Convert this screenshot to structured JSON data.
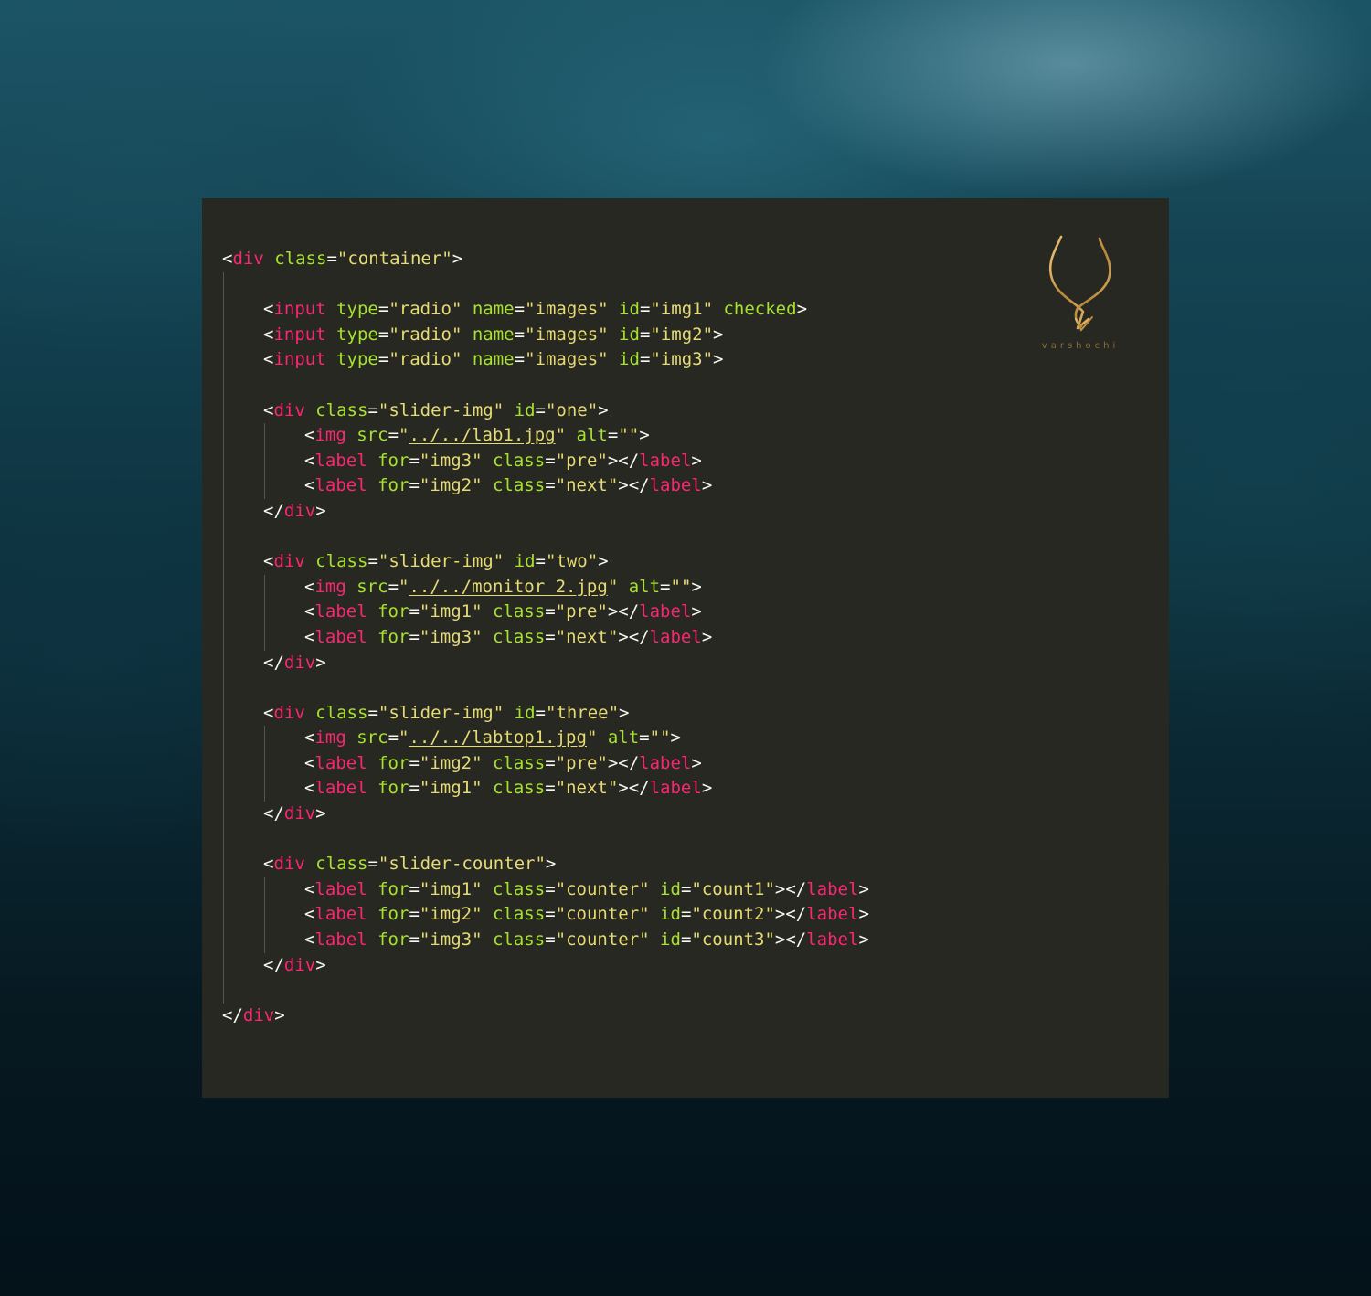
{
  "editor": {
    "lines": [
      {
        "indent": 0,
        "tokens": [
          [
            "pun",
            "<"
          ],
          [
            "tag",
            "div"
          ],
          [
            "pun",
            " "
          ],
          [
            "attr",
            "class"
          ],
          [
            "pun",
            "="
          ],
          [
            "str",
            "\"container\""
          ],
          [
            "pun",
            ">"
          ]
        ]
      },
      {
        "indent": 0,
        "tokens": []
      },
      {
        "indent": 1,
        "tokens": [
          [
            "pun",
            "<"
          ],
          [
            "tag",
            "input"
          ],
          [
            "pun",
            " "
          ],
          [
            "attr",
            "type"
          ],
          [
            "pun",
            "="
          ],
          [
            "str",
            "\"radio\""
          ],
          [
            "pun",
            " "
          ],
          [
            "attr",
            "name"
          ],
          [
            "pun",
            "="
          ],
          [
            "str",
            "\"images\""
          ],
          [
            "pun",
            " "
          ],
          [
            "attr",
            "id"
          ],
          [
            "pun",
            "="
          ],
          [
            "str",
            "\"img1\""
          ],
          [
            "pun",
            " "
          ],
          [
            "attr",
            "checked"
          ],
          [
            "pun",
            ">"
          ]
        ]
      },
      {
        "indent": 1,
        "tokens": [
          [
            "pun",
            "<"
          ],
          [
            "tag",
            "input"
          ],
          [
            "pun",
            " "
          ],
          [
            "attr",
            "type"
          ],
          [
            "pun",
            "="
          ],
          [
            "str",
            "\"radio\""
          ],
          [
            "pun",
            " "
          ],
          [
            "attr",
            "name"
          ],
          [
            "pun",
            "="
          ],
          [
            "str",
            "\"images\""
          ],
          [
            "pun",
            " "
          ],
          [
            "attr",
            "id"
          ],
          [
            "pun",
            "="
          ],
          [
            "str",
            "\"img2\""
          ],
          [
            "pun",
            ">"
          ]
        ]
      },
      {
        "indent": 1,
        "tokens": [
          [
            "pun",
            "<"
          ],
          [
            "tag",
            "input"
          ],
          [
            "pun",
            " "
          ],
          [
            "attr",
            "type"
          ],
          [
            "pun",
            "="
          ],
          [
            "str",
            "\"radio\""
          ],
          [
            "pun",
            " "
          ],
          [
            "attr",
            "name"
          ],
          [
            "pun",
            "="
          ],
          [
            "str",
            "\"images\""
          ],
          [
            "pun",
            " "
          ],
          [
            "attr",
            "id"
          ],
          [
            "pun",
            "="
          ],
          [
            "str",
            "\"img3\""
          ],
          [
            "pun",
            ">"
          ]
        ]
      },
      {
        "indent": 0,
        "tokens": []
      },
      {
        "indent": 1,
        "tokens": [
          [
            "pun",
            "<"
          ],
          [
            "tag",
            "div"
          ],
          [
            "pun",
            " "
          ],
          [
            "attr",
            "class"
          ],
          [
            "pun",
            "="
          ],
          [
            "str",
            "\"slider-img\""
          ],
          [
            "pun",
            " "
          ],
          [
            "attr",
            "id"
          ],
          [
            "pun",
            "="
          ],
          [
            "str",
            "\"one\""
          ],
          [
            "pun",
            ">"
          ]
        ]
      },
      {
        "indent": 2,
        "tokens": [
          [
            "pun",
            "<"
          ],
          [
            "tag",
            "img"
          ],
          [
            "pun",
            " "
          ],
          [
            "attr",
            "src"
          ],
          [
            "pun",
            "="
          ],
          [
            "str",
            "\""
          ],
          [
            "link",
            "../../lab1.jpg"
          ],
          [
            "str",
            "\""
          ],
          [
            "pun",
            " "
          ],
          [
            "attr",
            "alt"
          ],
          [
            "pun",
            "="
          ],
          [
            "str",
            "\"\""
          ],
          [
            "pun",
            ">"
          ]
        ]
      },
      {
        "indent": 2,
        "tokens": [
          [
            "pun",
            "<"
          ],
          [
            "tag",
            "label"
          ],
          [
            "pun",
            " "
          ],
          [
            "attr",
            "for"
          ],
          [
            "pun",
            "="
          ],
          [
            "str",
            "\"img3\""
          ],
          [
            "pun",
            " "
          ],
          [
            "attr",
            "class"
          ],
          [
            "pun",
            "="
          ],
          [
            "str",
            "\"pre\""
          ],
          [
            "pun",
            "></"
          ],
          [
            "tag",
            "label"
          ],
          [
            "pun",
            ">"
          ]
        ]
      },
      {
        "indent": 2,
        "tokens": [
          [
            "pun",
            "<"
          ],
          [
            "tag",
            "label"
          ],
          [
            "pun",
            " "
          ],
          [
            "attr",
            "for"
          ],
          [
            "pun",
            "="
          ],
          [
            "str",
            "\"img2\""
          ],
          [
            "pun",
            " "
          ],
          [
            "attr",
            "class"
          ],
          [
            "pun",
            "="
          ],
          [
            "str",
            "\"next\""
          ],
          [
            "pun",
            "></"
          ],
          [
            "tag",
            "label"
          ],
          [
            "pun",
            ">"
          ]
        ]
      },
      {
        "indent": 1,
        "tokens": [
          [
            "pun",
            "</"
          ],
          [
            "tag",
            "div"
          ],
          [
            "pun",
            ">"
          ]
        ]
      },
      {
        "indent": 0,
        "tokens": []
      },
      {
        "indent": 1,
        "tokens": [
          [
            "pun",
            "<"
          ],
          [
            "tag",
            "div"
          ],
          [
            "pun",
            " "
          ],
          [
            "attr",
            "class"
          ],
          [
            "pun",
            "="
          ],
          [
            "str",
            "\"slider-img\""
          ],
          [
            "pun",
            " "
          ],
          [
            "attr",
            "id"
          ],
          [
            "pun",
            "="
          ],
          [
            "str",
            "\"two\""
          ],
          [
            "pun",
            ">"
          ]
        ]
      },
      {
        "indent": 2,
        "tokens": [
          [
            "pun",
            "<"
          ],
          [
            "tag",
            "img"
          ],
          [
            "pun",
            " "
          ],
          [
            "attr",
            "src"
          ],
          [
            "pun",
            "="
          ],
          [
            "str",
            "\""
          ],
          [
            "link",
            "../../monitor 2.jpg"
          ],
          [
            "str",
            "\""
          ],
          [
            "pun",
            " "
          ],
          [
            "attr",
            "alt"
          ],
          [
            "pun",
            "="
          ],
          [
            "str",
            "\"\""
          ],
          [
            "pun",
            ">"
          ]
        ]
      },
      {
        "indent": 2,
        "tokens": [
          [
            "pun",
            "<"
          ],
          [
            "tag",
            "label"
          ],
          [
            "pun",
            " "
          ],
          [
            "attr",
            "for"
          ],
          [
            "pun",
            "="
          ],
          [
            "str",
            "\"img1\""
          ],
          [
            "pun",
            " "
          ],
          [
            "attr",
            "class"
          ],
          [
            "pun",
            "="
          ],
          [
            "str",
            "\"pre\""
          ],
          [
            "pun",
            "></"
          ],
          [
            "tag",
            "label"
          ],
          [
            "pun",
            ">"
          ]
        ]
      },
      {
        "indent": 2,
        "tokens": [
          [
            "pun",
            "<"
          ],
          [
            "tag",
            "label"
          ],
          [
            "pun",
            " "
          ],
          [
            "attr",
            "for"
          ],
          [
            "pun",
            "="
          ],
          [
            "str",
            "\"img3\""
          ],
          [
            "pun",
            " "
          ],
          [
            "attr",
            "class"
          ],
          [
            "pun",
            "="
          ],
          [
            "str",
            "\"next\""
          ],
          [
            "pun",
            "></"
          ],
          [
            "tag",
            "label"
          ],
          [
            "pun",
            ">"
          ]
        ]
      },
      {
        "indent": 1,
        "tokens": [
          [
            "pun",
            "</"
          ],
          [
            "tag",
            "div"
          ],
          [
            "pun",
            ">"
          ]
        ]
      },
      {
        "indent": 0,
        "tokens": []
      },
      {
        "indent": 1,
        "tokens": [
          [
            "pun",
            "<"
          ],
          [
            "tag",
            "div"
          ],
          [
            "pun",
            " "
          ],
          [
            "attr",
            "class"
          ],
          [
            "pun",
            "="
          ],
          [
            "str",
            "\"slider-img\""
          ],
          [
            "pun",
            " "
          ],
          [
            "attr",
            "id"
          ],
          [
            "pun",
            "="
          ],
          [
            "str",
            "\"three\""
          ],
          [
            "pun",
            ">"
          ]
        ]
      },
      {
        "indent": 2,
        "tokens": [
          [
            "pun",
            "<"
          ],
          [
            "tag",
            "img"
          ],
          [
            "pun",
            " "
          ],
          [
            "attr",
            "src"
          ],
          [
            "pun",
            "="
          ],
          [
            "str",
            "\""
          ],
          [
            "link",
            "../../labtop1.jpg"
          ],
          [
            "str",
            "\""
          ],
          [
            "pun",
            " "
          ],
          [
            "attr",
            "alt"
          ],
          [
            "pun",
            "="
          ],
          [
            "str",
            "\"\""
          ],
          [
            "pun",
            ">"
          ]
        ]
      },
      {
        "indent": 2,
        "tokens": [
          [
            "pun",
            "<"
          ],
          [
            "tag",
            "label"
          ],
          [
            "pun",
            " "
          ],
          [
            "attr",
            "for"
          ],
          [
            "pun",
            "="
          ],
          [
            "str",
            "\"img2\""
          ],
          [
            "pun",
            " "
          ],
          [
            "attr",
            "class"
          ],
          [
            "pun",
            "="
          ],
          [
            "str",
            "\"pre\""
          ],
          [
            "pun",
            "></"
          ],
          [
            "tag",
            "label"
          ],
          [
            "pun",
            ">"
          ]
        ]
      },
      {
        "indent": 2,
        "tokens": [
          [
            "pun",
            "<"
          ],
          [
            "tag",
            "label"
          ],
          [
            "pun",
            " "
          ],
          [
            "attr",
            "for"
          ],
          [
            "pun",
            "="
          ],
          [
            "str",
            "\"img1\""
          ],
          [
            "pun",
            " "
          ],
          [
            "attr",
            "class"
          ],
          [
            "pun",
            "="
          ],
          [
            "str",
            "\"next\""
          ],
          [
            "pun",
            "></"
          ],
          [
            "tag",
            "label"
          ],
          [
            "pun",
            ">"
          ]
        ]
      },
      {
        "indent": 1,
        "tokens": [
          [
            "pun",
            "</"
          ],
          [
            "tag",
            "div"
          ],
          [
            "pun",
            ">"
          ]
        ]
      },
      {
        "indent": 0,
        "tokens": []
      },
      {
        "indent": 1,
        "tokens": [
          [
            "pun",
            "<"
          ],
          [
            "tag",
            "div"
          ],
          [
            "pun",
            " "
          ],
          [
            "attr",
            "class"
          ],
          [
            "pun",
            "="
          ],
          [
            "str",
            "\"slider-counter\""
          ],
          [
            "pun",
            ">"
          ]
        ]
      },
      {
        "indent": 2,
        "tokens": [
          [
            "pun",
            "<"
          ],
          [
            "tag",
            "label"
          ],
          [
            "pun",
            " "
          ],
          [
            "attr",
            "for"
          ],
          [
            "pun",
            "="
          ],
          [
            "str",
            "\"img1\""
          ],
          [
            "pun",
            " "
          ],
          [
            "attr",
            "class"
          ],
          [
            "pun",
            "="
          ],
          [
            "str",
            "\"counter\""
          ],
          [
            "pun",
            " "
          ],
          [
            "attr",
            "id"
          ],
          [
            "pun",
            "="
          ],
          [
            "str",
            "\"count1\""
          ],
          [
            "pun",
            "></"
          ],
          [
            "tag",
            "label"
          ],
          [
            "pun",
            ">"
          ]
        ]
      },
      {
        "indent": 2,
        "tokens": [
          [
            "pun",
            "<"
          ],
          [
            "tag",
            "label"
          ],
          [
            "pun",
            " "
          ],
          [
            "attr",
            "for"
          ],
          [
            "pun",
            "="
          ],
          [
            "str",
            "\"img2\""
          ],
          [
            "pun",
            " "
          ],
          [
            "attr",
            "class"
          ],
          [
            "pun",
            "="
          ],
          [
            "str",
            "\"counter\""
          ],
          [
            "pun",
            " "
          ],
          [
            "attr",
            "id"
          ],
          [
            "pun",
            "="
          ],
          [
            "str",
            "\"count2\""
          ],
          [
            "pun",
            "></"
          ],
          [
            "tag",
            "label"
          ],
          [
            "pun",
            ">"
          ]
        ]
      },
      {
        "indent": 2,
        "tokens": [
          [
            "pun",
            "<"
          ],
          [
            "tag",
            "label"
          ],
          [
            "pun",
            " "
          ],
          [
            "attr",
            "for"
          ],
          [
            "pun",
            "="
          ],
          [
            "str",
            "\"img3\""
          ],
          [
            "pun",
            " "
          ],
          [
            "attr",
            "class"
          ],
          [
            "pun",
            "="
          ],
          [
            "str",
            "\"counter\""
          ],
          [
            "pun",
            " "
          ],
          [
            "attr",
            "id"
          ],
          [
            "pun",
            "="
          ],
          [
            "str",
            "\"count3\""
          ],
          [
            "pun",
            "></"
          ],
          [
            "tag",
            "label"
          ],
          [
            "pun",
            ">"
          ]
        ]
      },
      {
        "indent": 1,
        "tokens": [
          [
            "pun",
            "</"
          ],
          [
            "tag",
            "div"
          ],
          [
            "pun",
            ">"
          ]
        ]
      },
      {
        "indent": 0,
        "tokens": []
      },
      {
        "indent": 0,
        "tokens": [
          [
            "pun",
            "</"
          ],
          [
            "tag",
            "div"
          ],
          [
            "pun",
            ">"
          ]
        ]
      }
    ]
  },
  "logo": {
    "icon": "antelope-horns-icon",
    "text": "varshochi",
    "color": "#c89a4a"
  },
  "colors": {
    "panel_bg": "#282823",
    "tag": "#f92672",
    "attribute": "#a6e22e",
    "string": "#e6db74",
    "punctuation": "#f8f8f2"
  }
}
